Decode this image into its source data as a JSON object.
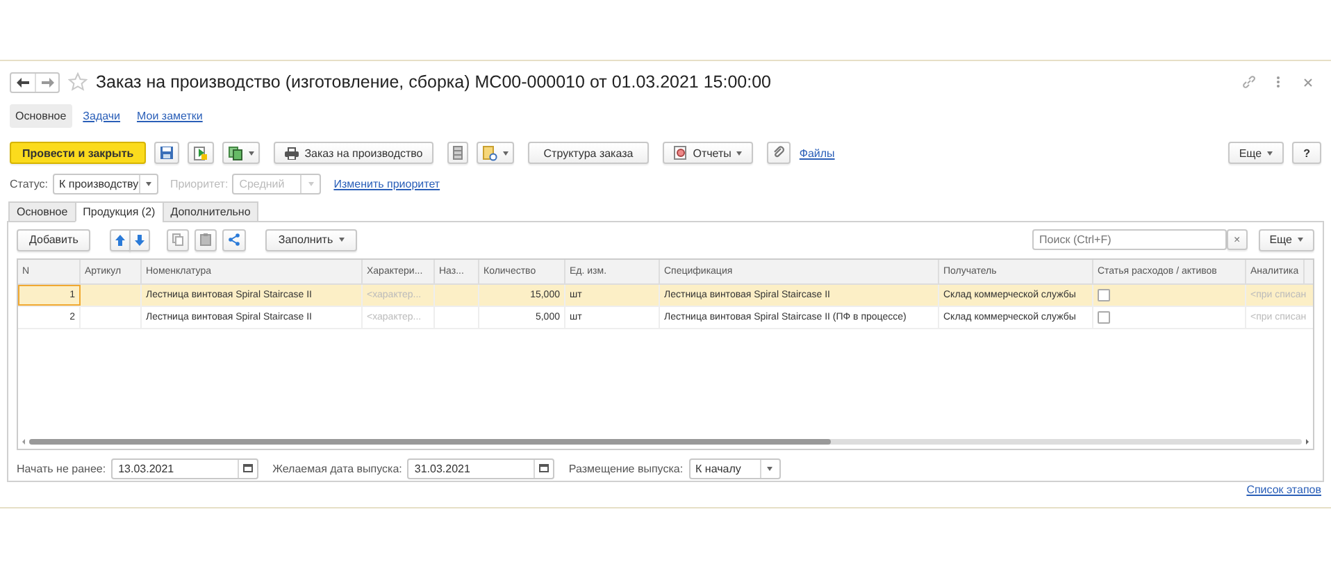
{
  "window": {
    "title": "Заказ на производство (изготовление, сборка) МС00-000010 от 01.03.2021 15:00:00",
    "favorite": false
  },
  "nav": [
    {
      "label": "Основное",
      "selected": true
    },
    {
      "label": "Задачи",
      "selected": false
    },
    {
      "label": "Мои заметки",
      "selected": false
    }
  ],
  "toolbar": {
    "post_button": "Провести и закрыть",
    "print_button": "Заказ на производство",
    "structure_button": "Структура заказа",
    "reports_button": "Отчеты",
    "files_link": "Файлы",
    "more_button": "Еще",
    "help_button": "?"
  },
  "status": {
    "label": "Статус:",
    "value": "К производству"
  },
  "priority": {
    "label": "Приоритет:",
    "value": "Средний",
    "disabled": true,
    "link": "Изменить приоритет"
  },
  "tabs": [
    {
      "label": "Основное",
      "selected": false
    },
    {
      "label": "Продукция (2)",
      "selected": true
    },
    {
      "label": "Дополнительно",
      "selected": false
    }
  ],
  "table_toolbar": {
    "add_button": "Добавить",
    "fill_button": "Заполнить",
    "search": {
      "placeholder": "Поиск (Ctrl+F)"
    },
    "clear_button": "×",
    "more_button": "Еще"
  },
  "table": {
    "columns": [
      "N",
      "Артикул",
      "Номенклатура",
      "Характери...",
      "Наз...",
      "Количество",
      "Ед. изм.",
      "Спецификация",
      "Получатель",
      "Статья расходов / активов",
      "Аналитика"
    ],
    "rows": [
      {
        "selected": true,
        "n": "1",
        "nomenclature": "Лестница винтовая Spiral Staircase II",
        "characteristic": "<характер...",
        "quantity": "15,000",
        "unit": "шт",
        "specification": "Лестница винтовая Spiral Staircase II",
        "recipient": "Склад коммерческой службы",
        "expense_checked": false,
        "analytics": "<при списан"
      },
      {
        "selected": false,
        "n": "2",
        "nomenclature": "Лестница винтовая Spiral Staircase II",
        "characteristic": "<характер...",
        "quantity": "5,000",
        "unit": "шт",
        "specification": "Лестница винтовая Spiral Staircase II (ПФ в процессе)",
        "recipient": "Склад коммерческой службы",
        "expense_checked": false,
        "analytics": "<при списан"
      }
    ]
  },
  "footer_fields": [
    {
      "kind": "date",
      "label": "Начать не ранее:",
      "value": "13.03.2021"
    },
    {
      "kind": "date",
      "label": "Желаемая дата выпуска:",
      "value": "31.03.2021"
    },
    {
      "kind": "select",
      "label": "Размещение выпуска:",
      "value": "К началу"
    }
  ],
  "stages_link": "Список этапов"
}
